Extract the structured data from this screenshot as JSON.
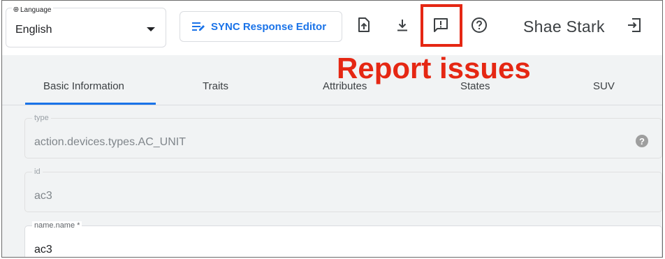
{
  "language": {
    "legend": "Language",
    "value": "English"
  },
  "toolbar": {
    "sync_button_label": "SYNC Response Editor",
    "user_name": "Shae Stark"
  },
  "annotation": {
    "text": "Report issues",
    "color": "#e52713"
  },
  "tabs": [
    {
      "label": "Basic Information",
      "selected": true
    },
    {
      "label": "Traits",
      "selected": false
    },
    {
      "label": "Attributes",
      "selected": false
    },
    {
      "label": "States",
      "selected": false
    },
    {
      "label": "SUV",
      "selected": false
    }
  ],
  "fields": {
    "type": {
      "label": "type",
      "value": "action.devices.types.AC_UNIT",
      "help_glyph": "?"
    },
    "id": {
      "label": "id",
      "value": "ac3"
    },
    "name": {
      "label": "name.name *",
      "value": "ac3"
    }
  },
  "colors": {
    "accent": "#1a73e8",
    "annotation_red": "#e52713"
  },
  "icons": [
    "globe-icon",
    "dropdown-caret-icon",
    "edit-notes-icon",
    "upload-icon",
    "download-icon",
    "feedback-icon",
    "help-icon",
    "logout-icon"
  ]
}
